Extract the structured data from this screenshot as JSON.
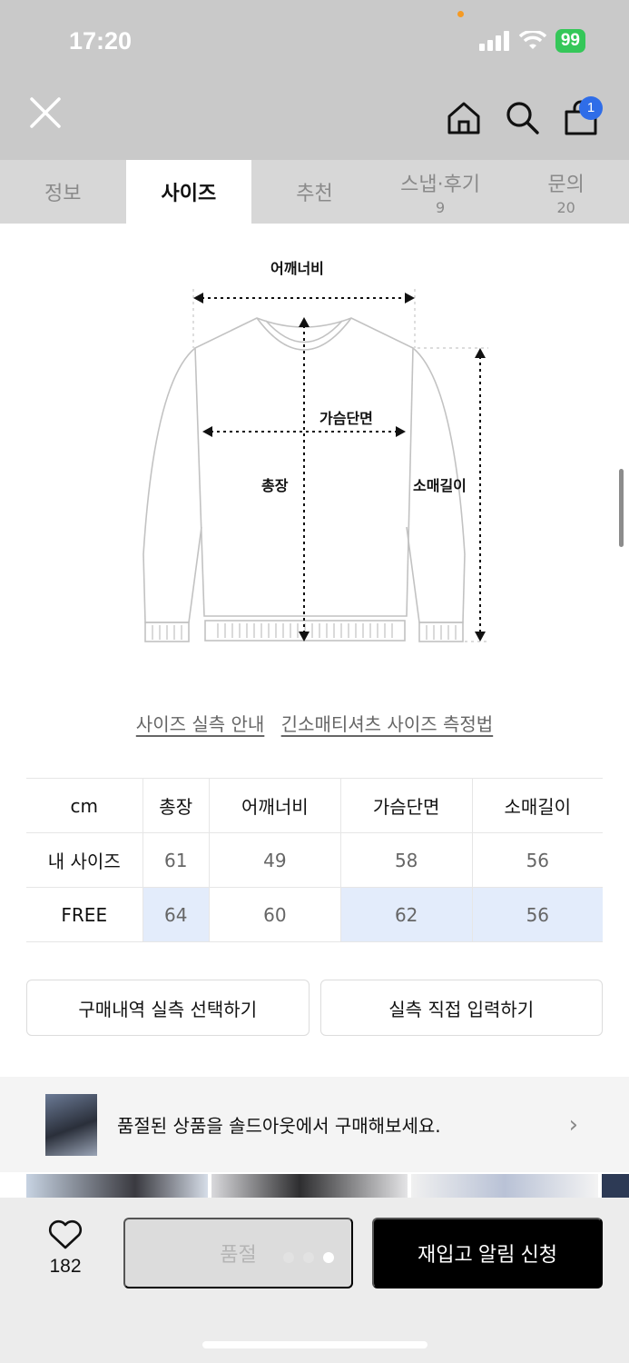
{
  "status_bar": {
    "time": "17:20",
    "battery": "99"
  },
  "header": {
    "close_icon": "close-icon",
    "home_icon": "home-icon",
    "search_icon": "search-icon",
    "cart_icon": "shopping-bag-icon",
    "cart_badge": "1"
  },
  "tabs": [
    {
      "label": "정보",
      "count": ""
    },
    {
      "label": "사이즈",
      "count": ""
    },
    {
      "label": "추천",
      "count": ""
    },
    {
      "label": "스냅·후기",
      "count": "9"
    },
    {
      "label": "문의",
      "count": "20"
    }
  ],
  "diagram": {
    "shoulder": "어깨너비",
    "chest": "가슴단면",
    "length": "총장",
    "sleeve": "소매길이"
  },
  "links": {
    "guide": "사이즈 실측 안내",
    "measure": "긴소매티셔츠 사이즈 측정법"
  },
  "size_table": {
    "unit": "cm",
    "headers": [
      "총장",
      "어깨너비",
      "가슴단면",
      "소매길이"
    ],
    "rows": [
      {
        "label": "내 사이즈",
        "values": [
          "61",
          "49",
          "58",
          "56"
        ]
      },
      {
        "label": "FREE",
        "values": [
          "64",
          "60",
          "62",
          "56"
        ]
      }
    ]
  },
  "actions": {
    "select_history": "구매내역 실측 선택하기",
    "manual_input": "실측 직접 입력하기"
  },
  "soldout_banner": {
    "text": "품절된 상품을 솔드아웃에서 구매해보세요."
  },
  "bottom_bar": {
    "like_count": "182",
    "soldout_label": "품절",
    "restock_label": "재입고 알림 신청"
  },
  "colors": {
    "highlight": "#e3ecfb",
    "badge": "#2f6de8",
    "primary_button": "#000000"
  }
}
